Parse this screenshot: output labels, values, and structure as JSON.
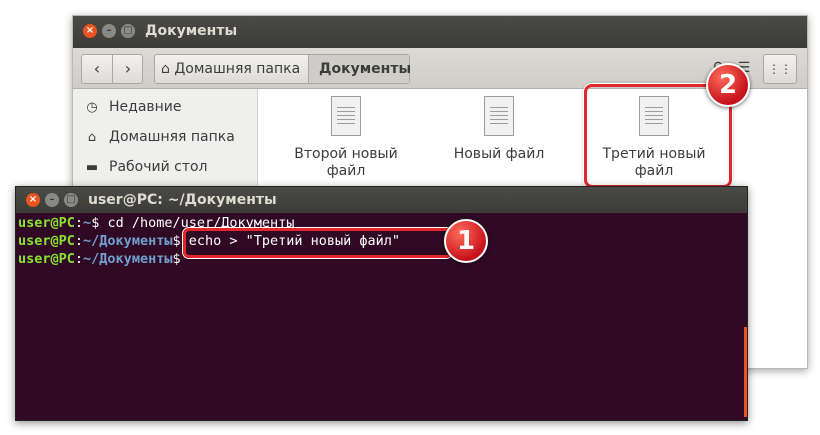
{
  "file_manager": {
    "title": "Документы",
    "window_controls": [
      "close",
      "minimize",
      "maximize"
    ],
    "breadcrumbs": [
      {
        "label": "Домашняя папка",
        "icon": "home-icon"
      },
      {
        "label": "Документы"
      }
    ],
    "toolbar_icons": [
      "search-icon",
      "list-view-icon",
      "grid-view-icon"
    ],
    "sidebar": [
      {
        "label": "Недавние",
        "icon": "clock-icon"
      },
      {
        "label": "Домашняя папка",
        "icon": "home-icon"
      },
      {
        "label": "Рабочий стол",
        "icon": "folder-icon"
      }
    ],
    "files": [
      {
        "name_line1": "Второй новый",
        "name_line2": "файл"
      },
      {
        "name_line1": "Новый файл",
        "name_line2": ""
      },
      {
        "name_line1": "Третий новый",
        "name_line2": "файл"
      }
    ]
  },
  "terminal": {
    "title": "user@PC: ~/Документы",
    "lines": [
      {
        "user": "user@PC",
        "path": "~",
        "prompt": "$",
        "command": " cd /home/user/Документы"
      },
      {
        "user": "user@PC",
        "path": "~/Документы",
        "prompt": "$",
        "command": " echo > \"Третий новый файл\""
      },
      {
        "user": "user@PC",
        "path": "~/Документы",
        "prompt": "$",
        "command": ""
      }
    ]
  },
  "annotations": {
    "step1": "1",
    "step2": "2"
  },
  "colors": {
    "terminal_bg": "#300a24",
    "ubuntu_orange": "#e95420",
    "highlight_red": "#e3262b",
    "prompt_user": "#8ae234",
    "prompt_path": "#729fcf"
  }
}
